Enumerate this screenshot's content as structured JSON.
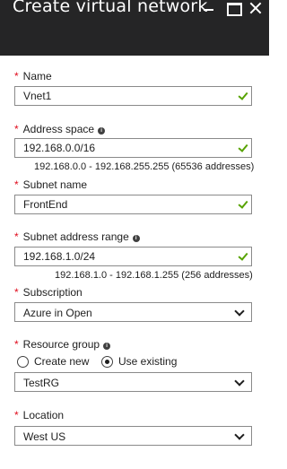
{
  "window": {
    "title": "Create virtual network"
  },
  "required_marker": "*",
  "info_glyph": "i",
  "fields": {
    "name": {
      "label": "Name",
      "value": "Vnet1"
    },
    "address_space": {
      "label": "Address space",
      "value": "192.168.0.0/16",
      "hint": "192.168.0.0 - 192.168.255.255 (65536 addresses)"
    },
    "subnet_name": {
      "label": "Subnet name",
      "value": "FrontEnd"
    },
    "subnet_range": {
      "label": "Subnet address range",
      "value": "192.168.1.0/24",
      "hint": "192.168.1.0 - 192.168.1.255 (256 addresses)"
    },
    "subscription": {
      "label": "Subscription",
      "value": "Azure in Open"
    },
    "resource_group": {
      "label": "Resource group",
      "options": [
        {
          "label": "Create new",
          "selected": false
        },
        {
          "label": "Use existing",
          "selected": true
        }
      ],
      "value": "TestRG"
    },
    "location": {
      "label": "Location",
      "value": "West US"
    }
  },
  "colors": {
    "header_bg": "#252526",
    "required": "#e00b1c",
    "valid_check": "#57a300",
    "field_border": "#8a8a8a"
  }
}
